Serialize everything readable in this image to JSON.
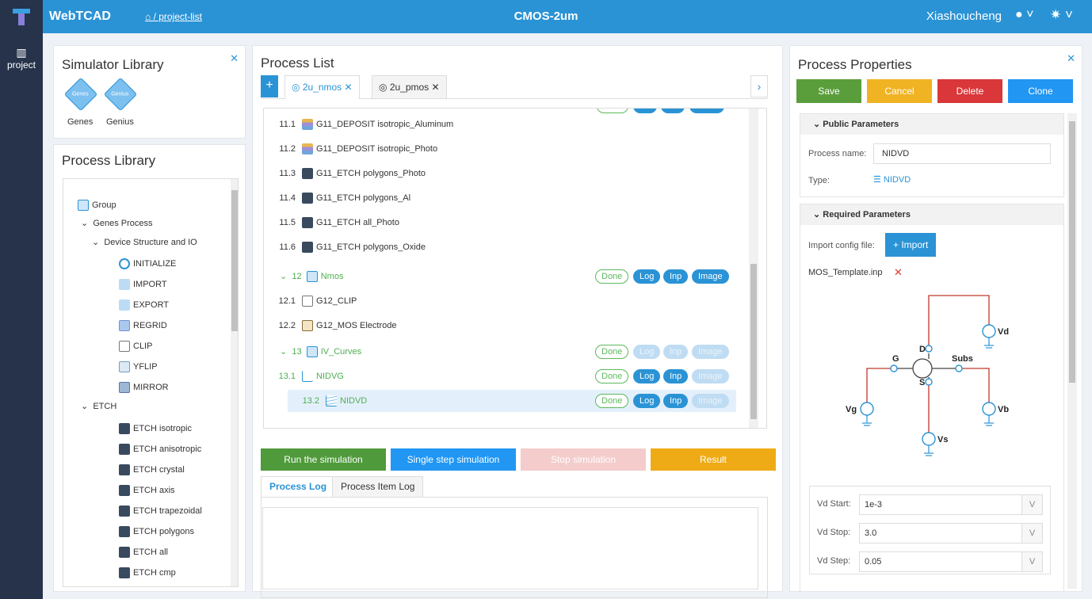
{
  "app": {
    "brand": "WebTCAD",
    "breadcrumb": "⌂ / project-list",
    "title": "CMOS-2um",
    "user": "Xiashoucheng"
  },
  "sidenav": {
    "item_label": "project"
  },
  "simulator_library": {
    "title": "Simulator Library",
    "items": [
      {
        "icon_text": "Genes",
        "label": "Genes"
      },
      {
        "icon_text": "Genius",
        "label": "Genius"
      }
    ]
  },
  "process_library": {
    "title": "Process Library",
    "tree": [
      {
        "label": "Group",
        "icon": "group-icon"
      },
      {
        "label": "Genes Process",
        "icon": "chevron-down-icon"
      },
      {
        "label": "Device Structure and IO",
        "icon": "chevron-down-icon"
      },
      {
        "label": "INITIALIZE",
        "icon": "initialize-icon"
      },
      {
        "label": "IMPORT",
        "icon": "import-icon"
      },
      {
        "label": "EXPORT",
        "icon": "export-icon"
      },
      {
        "label": "REGRID",
        "icon": "regrid-icon"
      },
      {
        "label": "CLIP",
        "icon": "clip-icon"
      },
      {
        "label": "YFLIP",
        "icon": "yflip-icon"
      },
      {
        "label": "MIRROR",
        "icon": "mirror-icon"
      },
      {
        "label": "ETCH",
        "icon": "chevron-down-icon"
      },
      {
        "label": "ETCH isotropic",
        "icon": "etch-icon"
      },
      {
        "label": "ETCH anisotropic",
        "icon": "etch-icon"
      },
      {
        "label": "ETCH crystal",
        "icon": "etch-icon"
      },
      {
        "label": "ETCH axis",
        "icon": "etch-icon"
      },
      {
        "label": "ETCH trapezoidal",
        "icon": "etch-icon"
      },
      {
        "label": "ETCH polygons",
        "icon": "etch-icon"
      },
      {
        "label": "ETCH all",
        "icon": "etch-icon"
      },
      {
        "label": "ETCH cmp",
        "icon": "etch-icon"
      }
    ]
  },
  "process_list": {
    "title": "Process List",
    "tabs": [
      {
        "label": "2u_nmos",
        "active": true
      },
      {
        "label": "2u_pmos",
        "active": false
      }
    ],
    "rows": [
      {
        "num": "11.1",
        "label": "G11_DEPOSIT isotropic_Aluminum",
        "icon": "deposit-icon"
      },
      {
        "num": "11.2",
        "label": "G11_DEPOSIT isotropic_Photo",
        "icon": "deposit-icon"
      },
      {
        "num": "11.3",
        "label": "G11_ETCH polygons_Photo",
        "icon": "etch-icon"
      },
      {
        "num": "11.4",
        "label": "G11_ETCH polygons_Al",
        "icon": "etch-icon"
      },
      {
        "num": "11.5",
        "label": "G11_ETCH all_Photo",
        "icon": "etch-icon"
      },
      {
        "num": "11.6",
        "label": "G11_ETCH polygons_Oxide",
        "icon": "etch-icon"
      },
      {
        "num": "12",
        "label": "Nmos",
        "icon": "group-icon",
        "group": true
      },
      {
        "num": "12.1",
        "label": "G12_CLIP",
        "icon": "clip-icon"
      },
      {
        "num": "12.2",
        "label": "G12_MOS Electrode",
        "icon": "electrode-icon"
      },
      {
        "num": "13",
        "label": "IV_Curves",
        "icon": "group-icon",
        "group": true
      },
      {
        "num": "13.1",
        "label": "NIDVG",
        "icon": "nidvg-icon"
      },
      {
        "num": "13.2",
        "label": "NIDVD",
        "icon": "nidvd-icon"
      }
    ],
    "pill_done": "Done",
    "pill_log": "Log",
    "pill_inp": "Inp",
    "pill_image": "Image",
    "buttons": {
      "run": "Run the simulation",
      "single": "Single step simulation",
      "stop": "Stop simulation",
      "result": "Result"
    },
    "log_tabs": [
      "Process Log",
      "Process Item Log"
    ]
  },
  "properties": {
    "title": "Process Properties",
    "buttons": {
      "save": "Save",
      "cancel": "Cancel",
      "delete": "Delete",
      "clone": "Clone"
    },
    "public": {
      "header": "Public Parameters",
      "name_label": "Process name:",
      "name_value": "NIDVD",
      "type_label": "Type:",
      "type_value": "NIDVD"
    },
    "required": {
      "header": "Required Parameters",
      "import_label": "Import config file:",
      "import_button": "+ Import",
      "file_name": "MOS_Template.inp",
      "circuit_labels": {
        "vd": "Vd",
        "d": "D",
        "g": "G",
        "subs": "Subs",
        "s": "S",
        "vg": "Vg",
        "vb": "Vb",
        "vs": "Vs"
      },
      "fields": [
        {
          "label": "Vd Start:",
          "value": "1e-3",
          "unit": "V"
        },
        {
          "label": "Vd Stop:",
          "value": "3.0",
          "unit": "V"
        },
        {
          "label": "Vd Step:",
          "value": "0.05",
          "unit": "V"
        }
      ]
    }
  },
  "colors": {
    "primary": "#2a93d5",
    "nav": "#26334b",
    "save": "#5a9e3c",
    "cancel": "#f0b323",
    "delete": "#d9373a",
    "clone": "#2196f3",
    "run": "#4f9a3a",
    "stop": "#f4cccc",
    "result": "#efab16"
  }
}
